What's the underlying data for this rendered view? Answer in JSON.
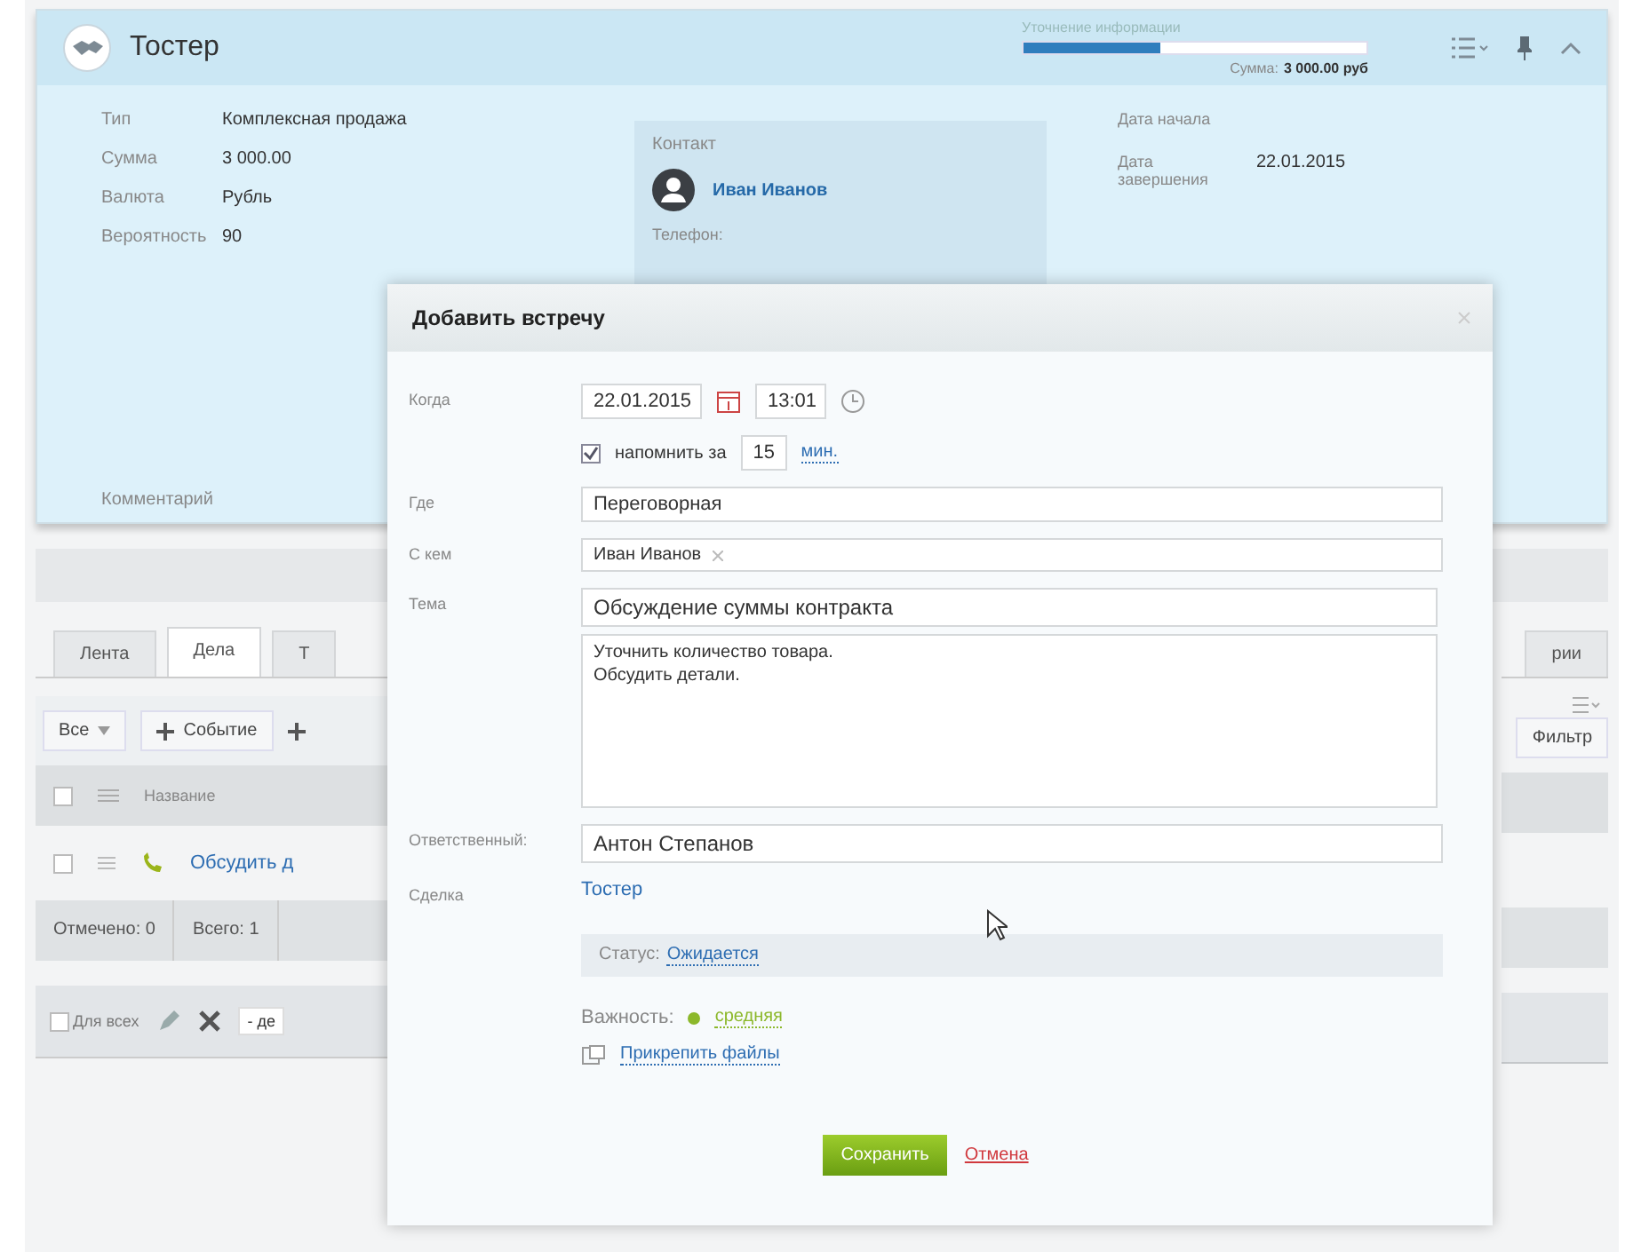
{
  "deal": {
    "title": "Тостер",
    "stage": {
      "label": "Уточнение информации",
      "level": 0.4
    },
    "sum": {
      "label": "Сумма:",
      "value": "3 000.00 руб"
    },
    "fields": [
      {
        "label": "Тип",
        "value": "Комплексная продажа"
      },
      {
        "label": "Сумма",
        "value": "3 000.00"
      },
      {
        "label": "Валюта",
        "value": "Рубль"
      },
      {
        "label": "Вероятность",
        "value": "90"
      }
    ],
    "comment_label": "Комментарий",
    "contact": {
      "heading": "Контакт",
      "name": "Иван Иванов",
      "phone_label": "Телефон:"
    },
    "dates": [
      {
        "label": "Дата начала"
      },
      {
        "label": "Дата завершения",
        "value": "22.01.2015"
      }
    ]
  },
  "tabs": [
    {
      "label": "Лента",
      "selected": false
    },
    {
      "label": "Дела",
      "selected": true
    },
    {
      "label": "Т",
      "selected": false
    }
  ],
  "tabs_right": [
    {
      "label": "рии",
      "selected": false
    }
  ],
  "toolbar": {
    "filter": "Все",
    "add_buttons": [
      "Событие"
    ],
    "filter_button": "Фильтр"
  },
  "table": {
    "header": "Название",
    "all_checked": false,
    "rows": [
      {
        "checked": false,
        "title": "Обсудить д"
      }
    ]
  },
  "footer": {
    "checked": "Отмечено: 0",
    "total": "Всего: 1"
  },
  "actions": {
    "for_all": {
      "label": "Для всех",
      "checked": false
    },
    "select": "- де"
  },
  "dialog": {
    "title": "Добавить встречу",
    "when": {
      "label": "Когда",
      "date": "22.01.2015",
      "time": "13:01"
    },
    "reminder": {
      "checked": true,
      "label": "напомнить за",
      "value": "15",
      "unit": "мин."
    },
    "where": {
      "label": "Где",
      "value": "Переговорная"
    },
    "with": {
      "label": "С кем",
      "value": "Иван Иванов"
    },
    "subject": {
      "label": "Тема",
      "value": "Обсуждение суммы контракта"
    },
    "description": "Уточнить количество товара.\nОбсудить детали.",
    "responsible": {
      "label": "Ответственный:",
      "value": "Антон Степанов"
    },
    "deal": {
      "label": "Сделка",
      "value": "Тостер"
    },
    "status": {
      "label": "Статус:",
      "value": "Ожидается"
    },
    "priority": {
      "label": "Важность:",
      "value": "средняя"
    },
    "attach": "Прикрепить файлы",
    "save": "Сохранить",
    "cancel": "Отмена"
  }
}
